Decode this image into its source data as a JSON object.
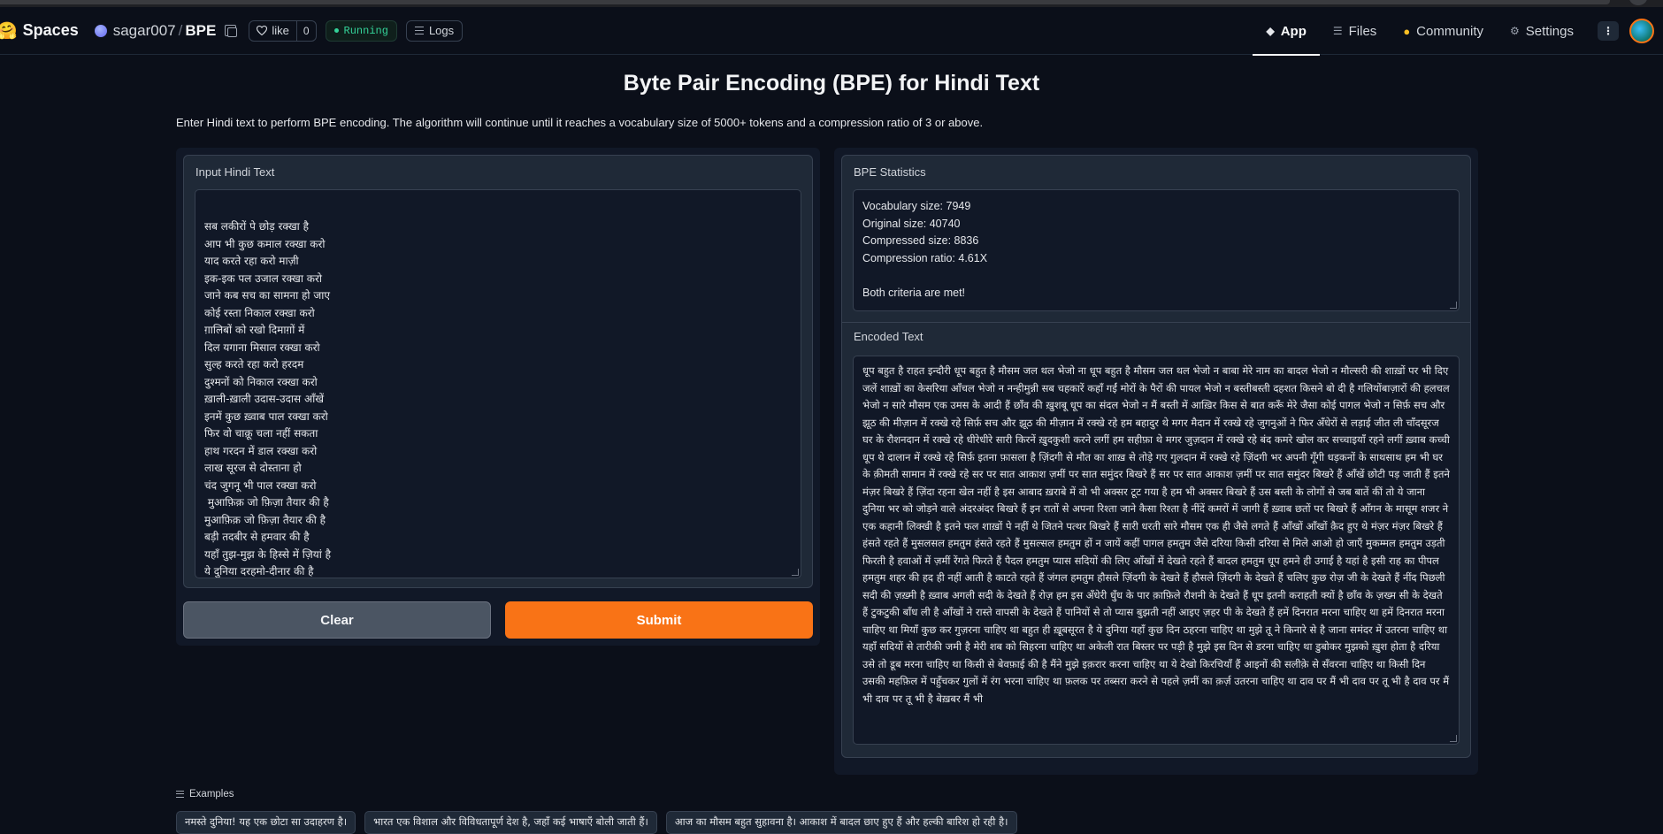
{
  "header": {
    "spaces_label": "Spaces",
    "repo_owner": "sagar007",
    "repo_slash": "/",
    "repo_name": "BPE",
    "like_label": "like",
    "like_count": "0",
    "status": "Running",
    "logs_label": "Logs",
    "nav": [
      {
        "label": "App",
        "active": true
      },
      {
        "label": "Files"
      },
      {
        "label": "Community"
      },
      {
        "label": "Settings"
      }
    ],
    "more_label": "⋮"
  },
  "app": {
    "title": "Byte Pair Encoding (BPE) for Hindi Text",
    "description": "Enter Hindi text to perform BPE encoding. The algorithm will continue until it reaches a vocabulary size of 5000+ tokens and a compression ratio of 3 or above.",
    "input_label": "Input Hindi Text",
    "input_text": "सब लकीरों पे छोड़ रक्खा है\nआप भी कुछ कमाल रक्खा करो\nयाद करते रहा करो माज़ी\nइक-इक पल उजाल रक्खा करो\nजाने कब सच का सामना हो जाए\nकोई रस्ता निकाल रक्खा करो\nग़ालिबों को रखो दिमाग़ों में\nदिल यगाना मिसाल रक्खा करो\nसुल्ह करते रहा करो हरदम\nदुश्मनों को निकाल रक्खा करो\nख़ाली-ख़ाली उदास-उदास आँखें\nइनमें कुछ ख़्वाब पाल रक्खा करो\nफिर वो चाक़ू चला नहीं सकता\nहाथ गरदन में डाल रक्खा करो\nलाख सूरज से दोस्ताना हो\nचंद जुगनू भी पाल रक्खा करो\n मुआफ़िक़ जो फ़िज़ा तैयार की है\nमुआफ़िक़ जो फ़िज़ा तैयार की है\nबड़ी तदबीर से हमवार की है\nयहाँ तुझ-मुझ के हिस्से में ज़ियां है\nये दुनिया दरहमो-दीनार की है\nयक़ीं कैसे करूं मैं मर चुका हूँ\nमगर अफ़्वाह सभी अख़बार की है",
    "clear_label": "Clear",
    "submit_label": "Submit",
    "stats_label": "BPE Statistics",
    "stats": {
      "vocab": "Vocabulary size: 7949",
      "original": "Original size: 40740",
      "compressed": "Compressed size: 8836",
      "ratio": "Compression ratio: 4.61X",
      "criteria": "Both criteria are met!"
    },
    "encoded_label": "Encoded Text",
    "encoded_text": "धूप बहुत है राहत इन्दौरी धूप बहुत है मौसम जल थल भेजो ना धूप बहुत है मौसम जल थल भेजो न बाबा मेरे नाम का बादल भेजो न मौल्सरी की शाख़ों पर भी दिए जलें शाख़ों का केसरिया आँचल भेजो न नन्हीमुन्नी सब चहकारें कहाँ गईं मोरों के पैरों की पायल भेजो न बस्तीबस्ती दहशत किसने बो दी है गलियोंबाज़ारों की हलचल भेजो न सारे मौसम एक उमस के आदी हैं छाँव की ख़ुशबू धूप का संदल भेजो न मैं बस्ती में आख़िर किस से बात करूँ मेरे जैसा कोई पागल भेजो न सिर्फ़ सच और झूठ की मीज़ान में रक्खे रहे सिर्फ़ सच और झूठ की मीज़ान में रक्खे रहे हम बहादुर थे मगर मैदान में रक्खे रहे जुगनुओं ने फिर अँधेरों से लड़ाई जीत ली चाँदसूरज घर के रौशनदान में रक्खे रहे धीरेधीरे सारी किरनें ख़ुदकुशी करने लगीं हम सहीफ़ा थे मगर जुज़दान में रक्खे रहे बंद कमरे खोल कर सच्चाइयाँ रहने लगीं ख़्वाब कच्ची धूप थे दालान में रक्खे रहे सिर्फ़ इतना फ़ासला है ज़िंदगी से मौत का शाख़ से तोड़े गए गुलदान में रक्खे रहे ज़िंदगी भर अपनी गूँगी धड़कनों के साथसाथ हम भी घर के क़ीमती सामान में रक्खे रहे सर पर सात आकाश ज़मीं पर सात समुंदर बिखरे हैं सर पर सात आकाश ज़मीं पर सात समुंदर बिखरे हैं आँखें छोटी पड़ जाती हैं इतने मंज़र बिखरे हैं ज़िंदा रहना खेल नहीं है इस आबाद ख़राबे में वो भी अक्सर टूट गया है हम भी अक्सर बिखरे हैं उस बस्ती के लोगों से जब बातें कीं तो ये जाना दुनिया भर को जोड़ने वाले अंदरअंदर बिखरे हैं इन रातों से अपना रिश्ता जाने कैसा रिश्ता है नींदें कमरों में जागी हैं ख़्वाब छतों पर बिखरे हैं आँगन के मासूम शजर ने एक कहानी लिक्खी है इतने फल शाख़ों पे नहीं थे जितने पत्थर बिखरे हैं सारी धरती सारे मौसम एक ही जैसे लगते हैं आँखों आँखों क़ैद हुए थे मंज़र मंज़र बिखरे हैं हंसते रहते हैं मुसलसल हमतुम हंसते रहते हैं मुसल्सल हमतुम हों न जायें कहीं पागल हमतुम जैसे दरिया किसी दरिया से मिले आओ हो जाएँ मुकम्मल हमतुम उड़ती फिरती है हवाओं में ज़मीं रेंगते फिरते हैं पैदल हमतुम प्यास सदियों की लिए आँखों में देखते रहते हैं बादल हमतुम धूप हमने ही उगाई है यहां है इसी राह का पीपल हमतुम शहर की हद ही नहीं आती है काटते रहते हैं जंगल हमतुम हौसले ज़िंदगी के देखते हैं हौसले ज़िंदगी के देखते हैं चलिए कुछ रोज़ जी के देखते हैं नींद पिछली सदी की ज़ख़्मी है ख़्वाब अगली सदी के देखते हैं रोज़ हम इस अँधेरी धुँध के पार क़ाफ़िले रौशनी के देखते हैं धूप इतनी कराहती क्यों है छाँव के ज़ख्म सी के देखते हैं टुकटुकी बाँध ली है आँखों ने रास्ते वापसी के देखते हैं पानियों से तो प्यास बुझती नहीं आइए ज़हर पी के देखते हैं हमें दिनरात मरना चाहिए था हमें दिनरात मरना चाहिए था मियाँ कुछ कर गुज़रना चाहिए था बहुत ही ख़ूबसूरत है ये दुनिया यहाँ कुछ दिन ठहरना चाहिए था मुझे तू ने किनारे से है जाना समंदर में उतरना चाहिए था यहाँ सदियों से तारीकी जमी है मेरी शब को सिहरना चाहिए था अकेली रात बिस्तर पर पड़ी है मुझे इस दिन से डरना चाहिए था डुबोकर मुझको ख़ुश होता है दरिया उसे तो डूब मरना चाहिए था किसी से बेवफ़ाई की है मैंने मुझे इक़रार करना चाहिए था ये देखो किरचियाँ हैं आइनों की सलीक़े से सँवरना चाहिए था किसी दिन उसकी महफ़िल में पहुँचकर गुलों में रंग भरना चाहिए था फ़लक पर तब्सरा करने से पहले ज़मीं का क़र्ज़ उतरना चाहिए था दाव पर मैं भी दाव पर तू भी है दाव पर मैं भी दाव पर तू भी है बेख़बर मैं भी",
    "examples_label": "Examples",
    "examples": [
      "नमस्ते दुनिया! यह एक छोटा सा उदाहरण है।",
      "भारत एक विशाल और विविधतापूर्ण देश है, जहाँ कई भाषाएँ बोली जाती हैं।",
      "आज का मौसम बहुत सुहावना है। आकाश में बादल छाए हुए हैं और हल्की बारिश हो रही है।"
    ]
  }
}
